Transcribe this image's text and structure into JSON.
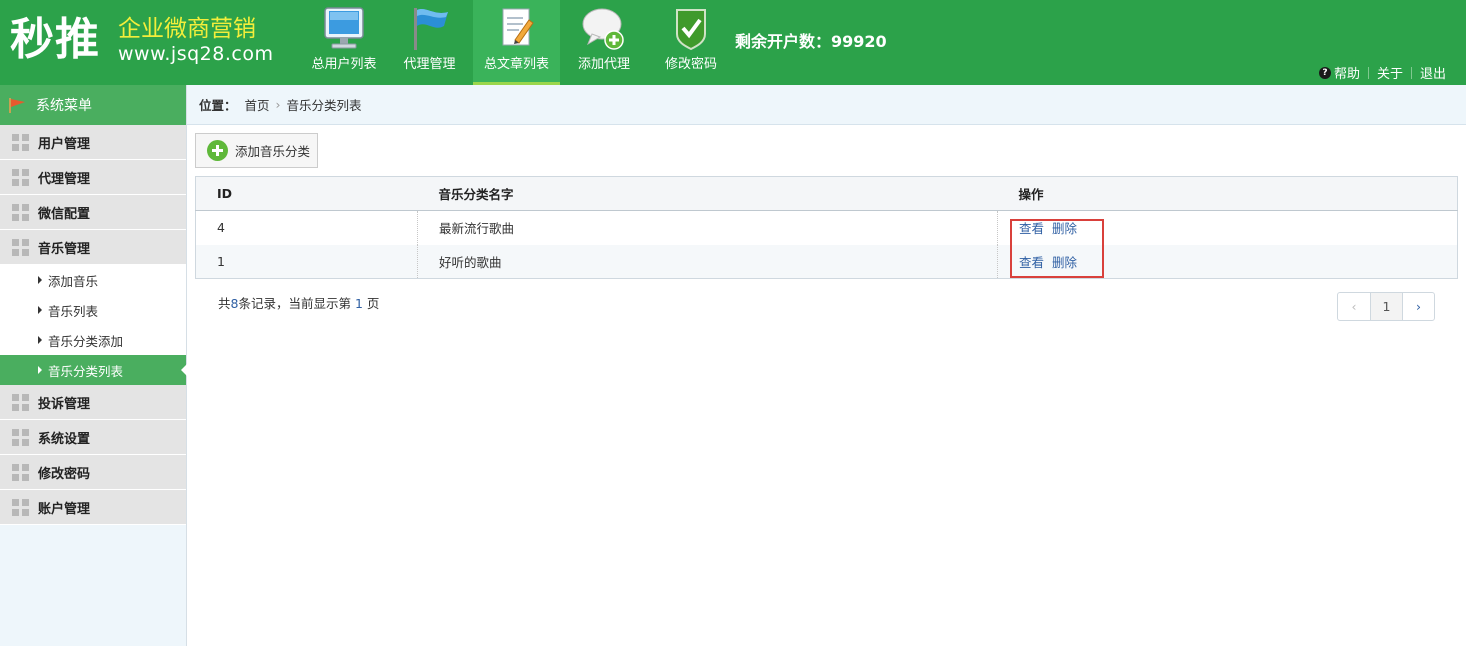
{
  "brand": {
    "logo_text": "秒推",
    "slogan": "企业微商营销",
    "url": "www.jsq28.com"
  },
  "nav": [
    {
      "label": "总用户列表",
      "icon": "monitor-icon"
    },
    {
      "label": "代理管理",
      "icon": "flag-icon"
    },
    {
      "label": "总文章列表",
      "icon": "document-edit-icon",
      "active": true
    },
    {
      "label": "添加代理",
      "icon": "chat-add-icon"
    },
    {
      "label": "修改密码",
      "icon": "shield-check-icon"
    }
  ],
  "remaining_accounts": "剩余开户数：99920",
  "top_links": {
    "help": "帮助",
    "about": "关于",
    "logout": "退出"
  },
  "sidebar": {
    "title": "系统菜单",
    "groups_top": [
      "用户管理",
      "代理管理",
      "微信配置",
      "音乐管理"
    ],
    "music_sub": [
      {
        "label": "添加音乐"
      },
      {
        "label": "音乐列表"
      },
      {
        "label": "音乐分类添加"
      },
      {
        "label": "音乐分类列表",
        "active": true
      }
    ],
    "groups_bottom": [
      "投诉管理",
      "系统设置",
      "修改密码",
      "账户管理"
    ]
  },
  "breadcrumb": {
    "label": "位置：",
    "home": "首页",
    "current": "音乐分类列表"
  },
  "add_button": "添加音乐分类",
  "table": {
    "headers": [
      "ID",
      "音乐分类名字",
      "操作"
    ],
    "rows": [
      {
        "id": "4",
        "name": "最新流行歌曲",
        "view": "查看",
        "delete": "删除"
      },
      {
        "id": "1",
        "name": "好听的歌曲",
        "view": "查看",
        "delete": "删除"
      }
    ]
  },
  "record_info": {
    "prefix": "共",
    "count": "8",
    "middle": "条记录，当前显示第",
    "page": "1",
    "suffix": "页"
  },
  "pager": {
    "prev": "‹",
    "current": "1",
    "next": "›"
  },
  "colors": {
    "header_green": "#2ca24a",
    "sidebar_active": "#4aae5f",
    "highlight_red": "#d9403b",
    "link_blue": "#2f5fa3"
  }
}
